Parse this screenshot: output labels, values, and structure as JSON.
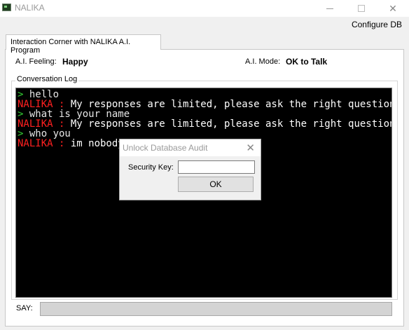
{
  "window": {
    "title": "NALIKA",
    "minimize_glyph": "",
    "maximize_glyph": "",
    "close_glyph": "✕"
  },
  "menu": {
    "configure_db": "Configure DB"
  },
  "tab": {
    "label": "Interaction Corner with NALIKA A.I. Program"
  },
  "status": {
    "feeling_label": "A.I. Feeling:",
    "feeling_value": "Happy",
    "mode_label": "A.I. Mode:",
    "mode_value": "OK to Talk"
  },
  "conversation": {
    "group_label": "Conversation Log",
    "lines": [
      {
        "type": "user",
        "prefix": "> ",
        "text": "hello"
      },
      {
        "type": "ai",
        "prefix": "NALIKA : ",
        "text": "My responses are limited, please ask the right questions!"
      },
      {
        "type": "user",
        "prefix": "> ",
        "text": "what is your name"
      },
      {
        "type": "ai",
        "prefix": "NALIKA : ",
        "text": "My responses are limited, please ask the right questions!"
      },
      {
        "type": "user",
        "prefix": "> ",
        "text": "who you"
      },
      {
        "type": "ai",
        "prefix": "NALIKA : ",
        "text": "im nobody"
      }
    ]
  },
  "say": {
    "label": "SAY:",
    "value": ""
  },
  "dialog": {
    "title": "Unlock Database Audit",
    "close_glyph": "✕",
    "key_label": "Security Key:",
    "key_value": "",
    "ok_label": "OK"
  },
  "colors": {
    "prompt": "#33cc33",
    "ai_name": "#ff2020",
    "log_background": "#000000"
  }
}
